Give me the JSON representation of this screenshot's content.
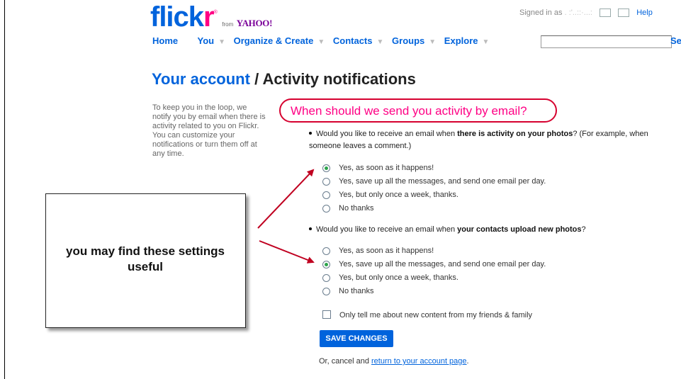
{
  "brand": {
    "logo_flickr_a": "flick",
    "logo_flickr_b": "r",
    "logo_reg": "®",
    "logo_from": "from",
    "logo_yahoo": "YAHOO!"
  },
  "header": {
    "signed_in": "Signed in as",
    "username_blurred": ". :'..::·...:",
    "help": "Help"
  },
  "nav": {
    "items": [
      {
        "label": "Home"
      },
      {
        "label": "You"
      },
      {
        "label": "Organize & Create"
      },
      {
        "label": "Contacts"
      },
      {
        "label": "Groups"
      },
      {
        "label": "Explore"
      }
    ],
    "search_button": "Se",
    "search_value": ""
  },
  "page": {
    "title_link": "Your account",
    "title_separator": " / ",
    "title_rest": "Activity notifications",
    "intro": "To keep you in the loop, we notify you by email when there is activity related to you on Flickr. You can customize your notifications or turn them off at any time.",
    "question": "When should we send you activity by email?"
  },
  "section1": {
    "prefix": "Would you like to receive an email when ",
    "bold": "there is activity on your photos",
    "suffix": "? (For example, when someone leaves a comment.)",
    "options": [
      {
        "label": "Yes, as soon as it happens!",
        "selected": true
      },
      {
        "label": "Yes, save up all the messages, and send one email per day.",
        "selected": false
      },
      {
        "label": "Yes, but only once a week, thanks.",
        "selected": false
      },
      {
        "label": "No thanks",
        "selected": false
      }
    ]
  },
  "section2": {
    "prefix": "Would you like to receive an email when ",
    "bold": "your contacts upload new photos",
    "suffix": "?",
    "options": [
      {
        "label": "Yes, as soon as it happens!",
        "selected": false
      },
      {
        "label": "Yes, save up all the messages, and send one email per day.",
        "selected": true
      },
      {
        "label": "Yes, but only once a week, thanks.",
        "selected": false
      },
      {
        "label": "No thanks",
        "selected": false
      }
    ]
  },
  "friends_only": {
    "label": "Only tell me about new content from my friends & family",
    "checked": false
  },
  "actions": {
    "save": "SAVE CHANGES",
    "cancel_prefix": "Or, cancel and ",
    "cancel_link": "return to your account page",
    "cancel_suffix": "."
  },
  "callout": {
    "text": "you may find these settings useful"
  },
  "colors": {
    "flickr_blue": "#0063dc",
    "flickr_pink": "#ff0084",
    "annotation_red": "#c00020"
  }
}
